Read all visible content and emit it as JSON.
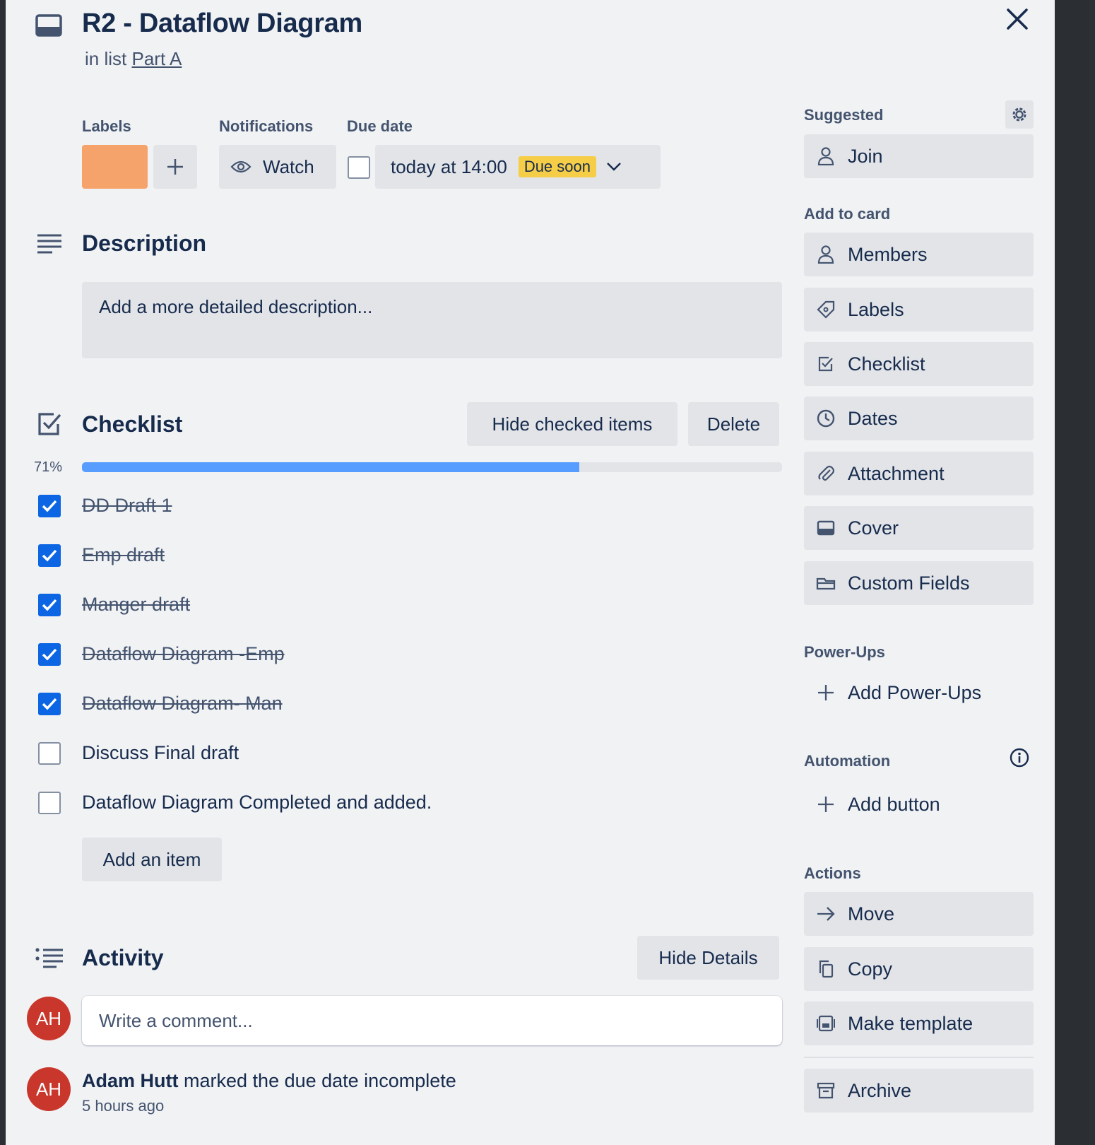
{
  "card": {
    "title": "R2 - Dataflow Diagram",
    "in_list_prefix": "in list",
    "list_name": "Part A"
  },
  "badges": {
    "labels_heading": "Labels",
    "label_color": "#f5a36b",
    "notifications_heading": "Notifications",
    "watch_label": "Watch",
    "due_heading": "Due date",
    "due_value": "today at 14:00",
    "due_status": "Due soon"
  },
  "description": {
    "heading": "Description",
    "placeholder": "Add a more detailed description..."
  },
  "checklist": {
    "heading": "Checklist",
    "hide_checked_label": "Hide checked items",
    "delete_label": "Delete",
    "progress_text": "71%",
    "progress_fraction": 0.71,
    "items": [
      {
        "text": "DD Draft 1",
        "checked": true
      },
      {
        "text": "Emp draft",
        "checked": true
      },
      {
        "text": "Manger draft",
        "checked": true
      },
      {
        "text": "Dataflow Diagram -Emp",
        "checked": true
      },
      {
        "text": "Dataflow Diagram- Man",
        "checked": true
      },
      {
        "text": "Discuss Final draft",
        "checked": false
      },
      {
        "text": "Dataflow Diagram Completed and added.",
        "checked": false
      }
    ],
    "add_item_label": "Add an item"
  },
  "activity": {
    "heading": "Activity",
    "hide_details_label": "Hide Details",
    "comment_placeholder": "Write a comment...",
    "avatar_initials": "AH",
    "entries": [
      {
        "user": "Adam Hutt",
        "action": "marked the due date incomplete",
        "time": "5 hours ago",
        "initials": "AH"
      }
    ]
  },
  "sidebar": {
    "suggested_heading": "Suggested",
    "join_label": "Join",
    "add_to_card_heading": "Add to card",
    "add_to_card": [
      "Members",
      "Labels",
      "Checklist",
      "Dates",
      "Attachment",
      "Cover",
      "Custom Fields"
    ],
    "powerups_heading": "Power-Ups",
    "add_powerups_label": "Add Power-Ups",
    "automation_heading": "Automation",
    "add_button_label": "Add button",
    "actions_heading": "Actions",
    "actions": [
      "Move",
      "Copy",
      "Make template",
      "Archive"
    ]
  },
  "colors": {
    "accent": "#0c66e4",
    "progress": "#579dff",
    "avatar": "#c9372c",
    "due_soon": "#f5cd47"
  }
}
